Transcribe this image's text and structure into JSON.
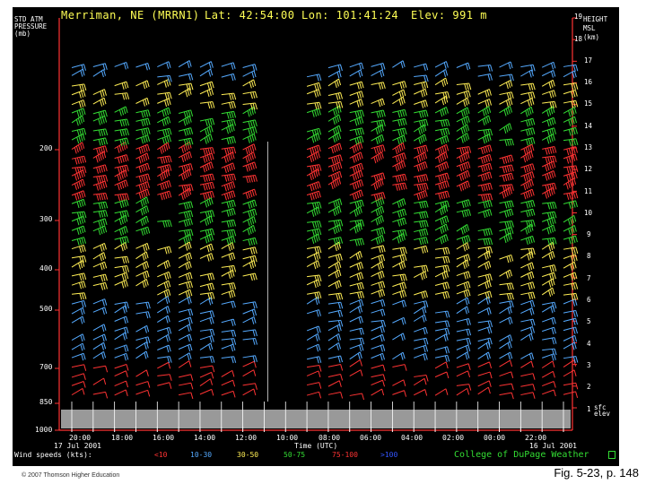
{
  "header": {
    "station": "Merriman, NE (MRRN1)",
    "lat": "Lat: 42:54:00",
    "lon": "Lon: 101:41:24",
    "elev": "Elev: 991 m"
  },
  "left_axis": {
    "title_lines": [
      "STD ATM",
      "PRESSURE",
      "(mb)"
    ],
    "ticks": [
      {
        "label": "200",
        "value": 200
      },
      {
        "label": "300",
        "value": 300
      },
      {
        "label": "400",
        "value": 400
      },
      {
        "label": "500",
        "value": 500
      },
      {
        "label": "700",
        "value": 700
      },
      {
        "label": "850",
        "value": 850
      },
      {
        "label": "1000",
        "value": 1000
      }
    ]
  },
  "right_axis": {
    "title_lines": [
      "HEIGHT",
      "MSL",
      "(km)"
    ],
    "ticks": [
      "19",
      "18",
      "17",
      "16",
      "15",
      "14",
      "13",
      "12",
      "11",
      "10",
      "9",
      "8",
      "7",
      "6",
      "5",
      "4",
      "3",
      "2",
      "1"
    ],
    "sfc_label": [
      "sfc",
      "elev"
    ]
  },
  "time_axis": {
    "ticks": [
      "20:00",
      "18:00",
      "16:00",
      "14:00",
      "12:00",
      "10:00",
      "08:00",
      "06:00",
      "04:00",
      "02:00",
      "00:00",
      "22:00"
    ],
    "start_date": "17 Jul 2001",
    "end_date": "16 Jul 2001",
    "title": "Time (UTC)"
  },
  "legend": {
    "label": "Wind speeds (kts):",
    "items": [
      {
        "label": "<10",
        "color": "#ff3333"
      },
      {
        "label": "10-30",
        "color": "#55aaff"
      },
      {
        "label": "30-50",
        "color": "#ffee55"
      },
      {
        "label": "50-75",
        "color": "#33dd33"
      },
      {
        "label": "75-100",
        "color": "#ff3333"
      },
      {
        "label": ">100",
        "color": "#3355ff"
      }
    ],
    "source": "College of DuPage Weather"
  },
  "credit": "© 2007 Thomson Higher Education",
  "caption": "Fig. 5-23, p. 148",
  "chart_data": {
    "type": "scatter",
    "title": "Merriman, NE (MRRN1) Lat: 42:54:00 Lon: 101:41:24 Elev: 991 m",
    "xlabel": "Time (UTC)",
    "ylabel": "STD ATM PRESSURE (mb)",
    "y2label": "HEIGHT MSL (km)",
    "x_ticks": [
      "20:00",
      "18:00",
      "16:00",
      "14:00",
      "12:00",
      "10:00",
      "08:00",
      "06:00",
      "04:00",
      "02:00",
      "00:00",
      "22:00"
    ],
    "ylim_km": [
      1,
      19
    ],
    "grid": false,
    "speed_categories": [
      {
        "range": "<10",
        "color": "#ff3333"
      },
      {
        "range": "10-30",
        "color": "#55aaff"
      },
      {
        "range": "30-50",
        "color": "#ffee55"
      },
      {
        "range": "50-75",
        "color": "#33dd33"
      },
      {
        "range": "75-100",
        "color": "#ff3333"
      },
      {
        "range": ">100",
        "color": "#3355ff"
      }
    ],
    "profiles_count": 24,
    "missing_profiles": [
      9,
      10
    ],
    "band_speed_by_km": [
      {
        "km_from": 1.5,
        "km_to": 3.0,
        "category": "<10"
      },
      {
        "km_from": 3.0,
        "km_to": 6.0,
        "category": "10-30"
      },
      {
        "km_from": 6.0,
        "km_to": 8.5,
        "category": "30-50"
      },
      {
        "km_from": 8.5,
        "km_to": 10.5,
        "category": "50-75"
      },
      {
        "km_from": 10.5,
        "km_to": 13.0,
        "category": "75-100"
      },
      {
        "km_from": 13.0,
        "km_to": 15.0,
        "category": "50-75"
      },
      {
        "km_from": 15.0,
        "km_to": 16.0,
        "category": "30-50"
      },
      {
        "km_from": 16.0,
        "km_to": 17.0,
        "category": "10-30"
      }
    ]
  }
}
